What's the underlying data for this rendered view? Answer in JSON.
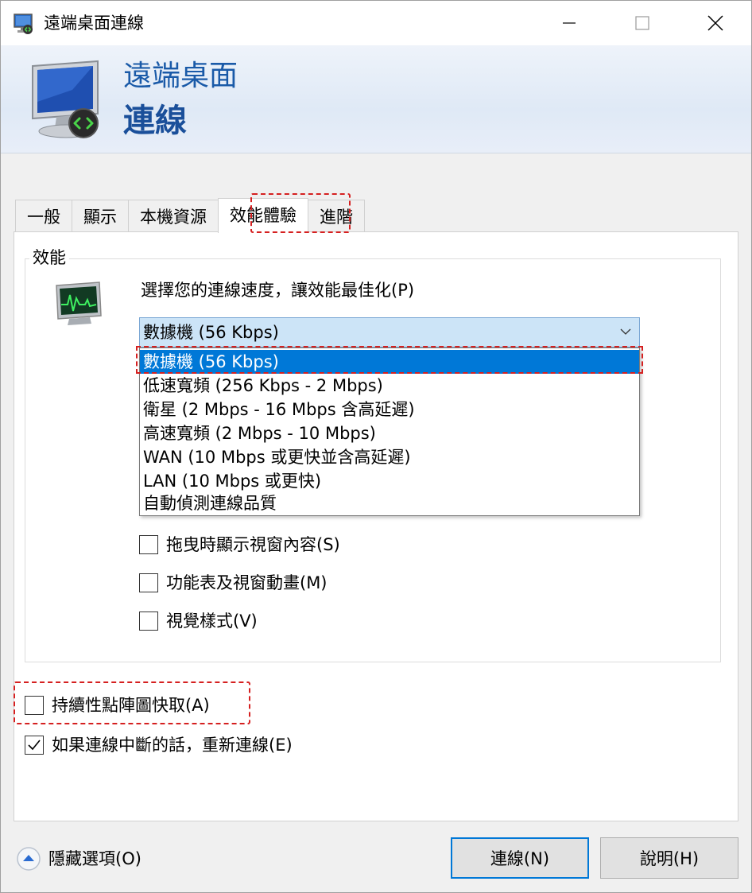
{
  "window": {
    "title": "遠端桌面連線",
    "icon": "remote-desktop-icon"
  },
  "banner": {
    "line1": "遠端桌面",
    "line2": "連線"
  },
  "tabs": [
    {
      "label": "一般",
      "active": false
    },
    {
      "label": "顯示",
      "active": false
    },
    {
      "label": "本機資源",
      "active": false
    },
    {
      "label": "效能體驗",
      "active": true
    },
    {
      "label": "進階",
      "active": false
    }
  ],
  "performance": {
    "group_title": "效能",
    "prompt": "選擇您的連線速度，讓效能最佳化(P)",
    "selected_speed": "數據機 (56 Kbps)",
    "speed_options": [
      "數據機 (56 Kbps)",
      "低速寬頻 (256 Kbps - 2 Mbps)",
      "衛星 (2 Mbps - 16 Mbps 含高延遲)",
      "高速寬頻 (2 Mbps - 10 Mbps)",
      "WAN (10 Mbps 或更快並含高延遲)",
      "LAN (10 Mbps 或更快)",
      "自動偵測連線品質"
    ],
    "checkboxes": [
      {
        "label": "拖曳時顯示視窗內容(S)",
        "checked": false
      },
      {
        "label": "功能表及視窗動畫(M)",
        "checked": false
      },
      {
        "label": "視覺樣式(V)",
        "checked": false
      }
    ]
  },
  "options": {
    "bitmap_cache": {
      "label": "持續性點陣圖快取(A)",
      "checked": false
    },
    "reconnect": {
      "label": "如果連線中斷的話，重新連線(E)",
      "checked": true
    }
  },
  "footer": {
    "hide_options": "隱藏選項(O)",
    "connect": "連線(N)",
    "help": "說明(H)"
  },
  "colors": {
    "accent": "#0078d7",
    "highlight": "#d52020",
    "banner_text": "#1a5aa8"
  }
}
